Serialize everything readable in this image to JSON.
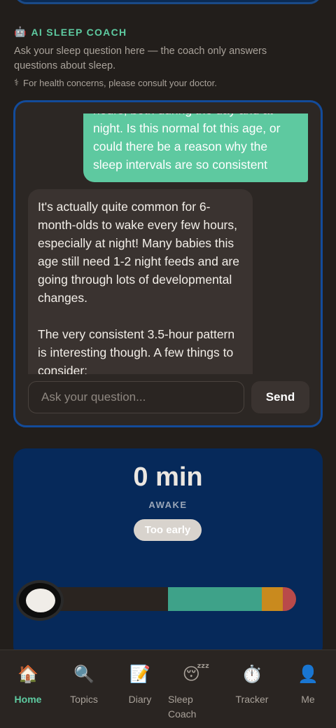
{
  "coach": {
    "icon": "robot-icon",
    "title": "AI SLEEP COACH",
    "description": "Ask your sleep question here — the coach only answers questions about sleep.",
    "disclaimer": "For health concerns, please consult your doctor.",
    "disclaimer_icon": "caduceus-icon"
  },
  "chat": {
    "user_message": "hours, both during the day and at night. Is this normal fot this age, or could there be a reason why the sleep intervals are so consistent",
    "bot_message": "It's actually quite common for 6-month-olds to wake every few hours, especially at night! Many babies this age still need 1-2 night feeds and are going through lots of developmental changes.\n\nThe very consistent 3.5-hour pattern is interesting though. A few things to consider:",
    "input_placeholder": "Ask your question...",
    "send_label": "Send"
  },
  "timer": {
    "value": "0 min",
    "state": "AWAKE",
    "badge": "Too early"
  },
  "tabs": [
    {
      "label": "Home",
      "icon": "house-icon",
      "glyph": "🏠",
      "active": true
    },
    {
      "label": "Topics",
      "icon": "magnifier-icon",
      "glyph": "🔍",
      "active": false
    },
    {
      "label": "Diary",
      "icon": "memo-icon",
      "glyph": "📝",
      "active": false
    },
    {
      "label": "Sleep\nCoach",
      "icon": "sleeping-face-icon",
      "glyph": "😴",
      "active": false
    },
    {
      "label": "Tracker",
      "icon": "stopwatch-icon",
      "glyph": "⏱️",
      "active": false
    },
    {
      "label": "Me",
      "icon": "person-icon",
      "glyph": "👤",
      "active": false
    }
  ],
  "colors": {
    "accent": "#5ecba1",
    "chat_border": "#134b9a",
    "timer_bg": "#06295a"
  }
}
